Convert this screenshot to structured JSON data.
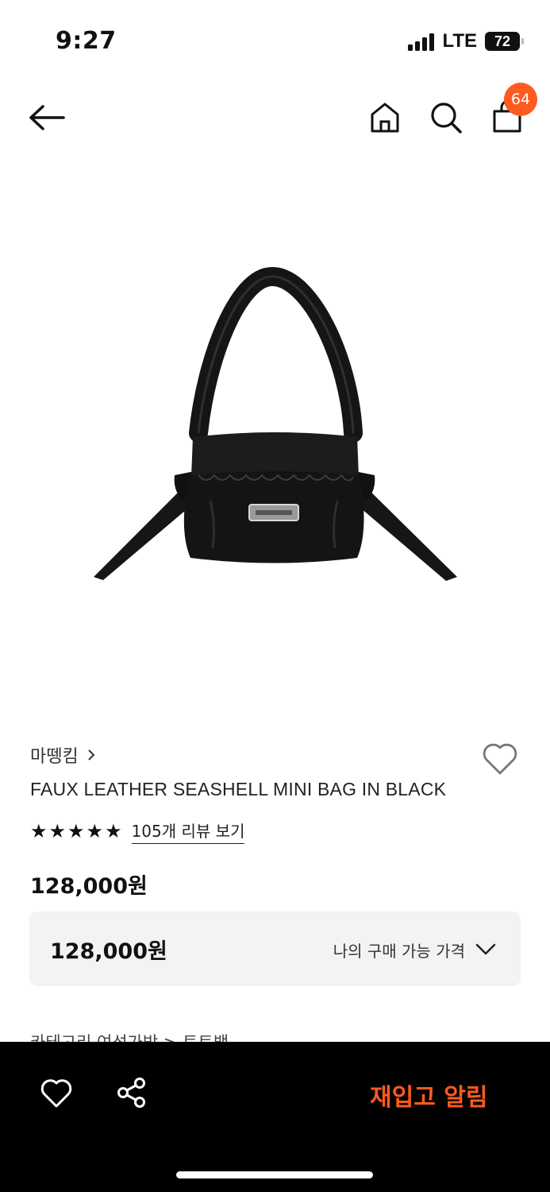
{
  "status_bar": {
    "time": "9:27",
    "network": "LTE",
    "battery": "72"
  },
  "header": {
    "icons": [
      "back-arrow-icon",
      "home-icon",
      "search-icon",
      "shopping-bag-icon"
    ],
    "cart_count": "64",
    "badge_color": "#ff5a1f"
  },
  "product": {
    "brand": "마뗑킴",
    "title": "FAUX LEATHER SEASHELL MINI BAG IN BLACK",
    "rating_stars": 5,
    "review_link": "105개 리뷰 보기",
    "price": "128,000원",
    "my_price": "128,000원",
    "my_price_label": "나의 구매 가능 가격",
    "category_peek": "카테고리      여성가방 > 토트백"
  },
  "bottom_bar": {
    "restock_label": "재입고 알림",
    "accent_color": "#ff5a1f"
  }
}
